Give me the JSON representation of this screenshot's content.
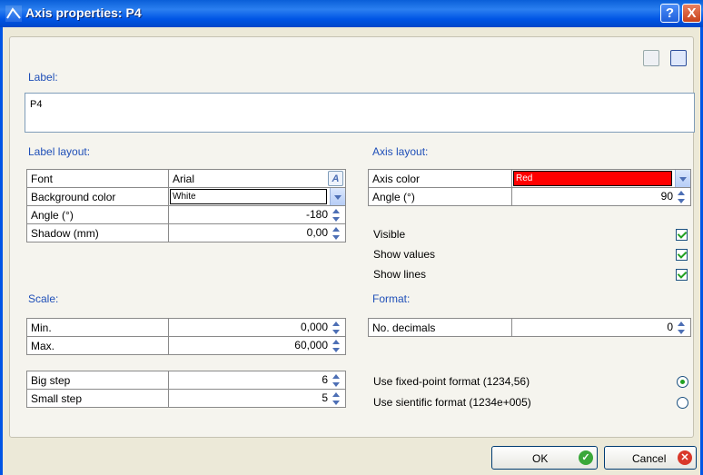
{
  "window": {
    "title": "Axis properties: P4",
    "help_label": "?",
    "close_label": "X"
  },
  "label_section": {
    "heading": "Label:",
    "value": "P4"
  },
  "label_layout": {
    "heading": "Label layout:",
    "font_key": "Font",
    "font_value": "Arial",
    "font_button": "A",
    "bg_key": "Background color",
    "bg_value": "White",
    "angle_key": "Angle (°)",
    "angle_value": "-180",
    "shadow_key": "Shadow (mm)",
    "shadow_value": "0,00"
  },
  "axis_layout": {
    "heading": "Axis layout:",
    "color_key": "Axis color",
    "color_value": "Red",
    "color_hex": "#ff0000",
    "angle_key": "Angle (°)",
    "angle_value": "90",
    "visible": "Visible",
    "show_values": "Show values",
    "show_lines": "Show lines"
  },
  "scale": {
    "heading": "Scale:",
    "min_key": "Min.",
    "min_value": "0,000",
    "max_key": "Max.",
    "max_value": "60,000",
    "big_key": "Big step",
    "big_value": "6",
    "small_key": "Small step",
    "small_value": "5"
  },
  "format": {
    "heading": "Format:",
    "decimals_key": "No. decimals",
    "decimals_value": "0",
    "fixed": "Use fixed-point format (1234,56)",
    "scientific": "Use sientific format (1234e+005)"
  },
  "buttons": {
    "ok": "OK",
    "cancel": "Cancel"
  }
}
